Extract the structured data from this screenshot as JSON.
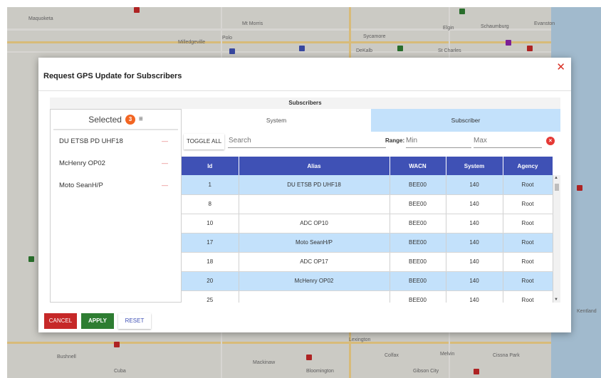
{
  "map": {
    "towns": [
      {
        "name": "Maquoketa"
      },
      {
        "name": "Mt Morris"
      },
      {
        "name": "Polo"
      },
      {
        "name": "Milledgeville"
      },
      {
        "name": "Sycamore"
      },
      {
        "name": "DeKalb"
      },
      {
        "name": "St Charles"
      },
      {
        "name": "Elgin"
      },
      {
        "name": "Schaumburg"
      },
      {
        "name": "Evanston"
      },
      {
        "name": "Bushnell"
      },
      {
        "name": "Cuba"
      },
      {
        "name": "Mackinaw"
      },
      {
        "name": "Bloomington"
      },
      {
        "name": "Lexington"
      },
      {
        "name": "Colfax"
      },
      {
        "name": "Melvin"
      },
      {
        "name": "Cissna Park"
      },
      {
        "name": "Kentland"
      },
      {
        "name": "Gibson City"
      }
    ]
  },
  "dialog": {
    "title": "Request GPS Update for Subscribers",
    "panel_caption": "Subscribers"
  },
  "selected": {
    "label": "Selected",
    "count": "3",
    "items": [
      {
        "label": "DU ETSB PD UHF18",
        "remove": "—"
      },
      {
        "label": "McHenry OP02",
        "remove": "—"
      },
      {
        "label": "Moto SeanH/P",
        "remove": "—"
      }
    ]
  },
  "tabs": {
    "system": "System",
    "subscriber": "Subscriber",
    "active": "Subscriber"
  },
  "filters": {
    "toggle_all": "TOGGLE ALL",
    "search_placeholder": "Search",
    "range_label": "Range:",
    "min_placeholder": "Min",
    "max_placeholder": "Max",
    "clear_glyph": "×"
  },
  "table": {
    "columns": [
      "Id",
      "Alias",
      "WACN",
      "System",
      "Agency"
    ],
    "rows": [
      {
        "id": "1",
        "alias": "DU ETSB PD UHF18",
        "wacn": "BEE00",
        "system": "140",
        "agency": "Root",
        "selected": true
      },
      {
        "id": "8",
        "alias": "",
        "wacn": "BEE00",
        "system": "140",
        "agency": "Root",
        "selected": false
      },
      {
        "id": "10",
        "alias": "ADC OP10",
        "wacn": "BEE00",
        "system": "140",
        "agency": "Root",
        "selected": false
      },
      {
        "id": "17",
        "alias": "Moto SeanH/P",
        "wacn": "BEE00",
        "system": "140",
        "agency": "Root",
        "selected": true
      },
      {
        "id": "18",
        "alias": "ADC OP17",
        "wacn": "BEE00",
        "system": "140",
        "agency": "Root",
        "selected": false
      },
      {
        "id": "20",
        "alias": "McHenry OP02",
        "wacn": "BEE00",
        "system": "140",
        "agency": "Root",
        "selected": true
      },
      {
        "id": "25",
        "alias": "",
        "wacn": "BEE00",
        "system": "140",
        "agency": "Root",
        "selected": false
      }
    ]
  },
  "footer": {
    "cancel": "CANCEL",
    "apply": "APPLY",
    "reset": "RESET"
  },
  "colors": {
    "header_blue": "#3f51b5",
    "row_highlight": "#c3e1fb",
    "cancel_red": "#c62828",
    "apply_green": "#2e7d32",
    "badge_orange": "#f26522"
  }
}
